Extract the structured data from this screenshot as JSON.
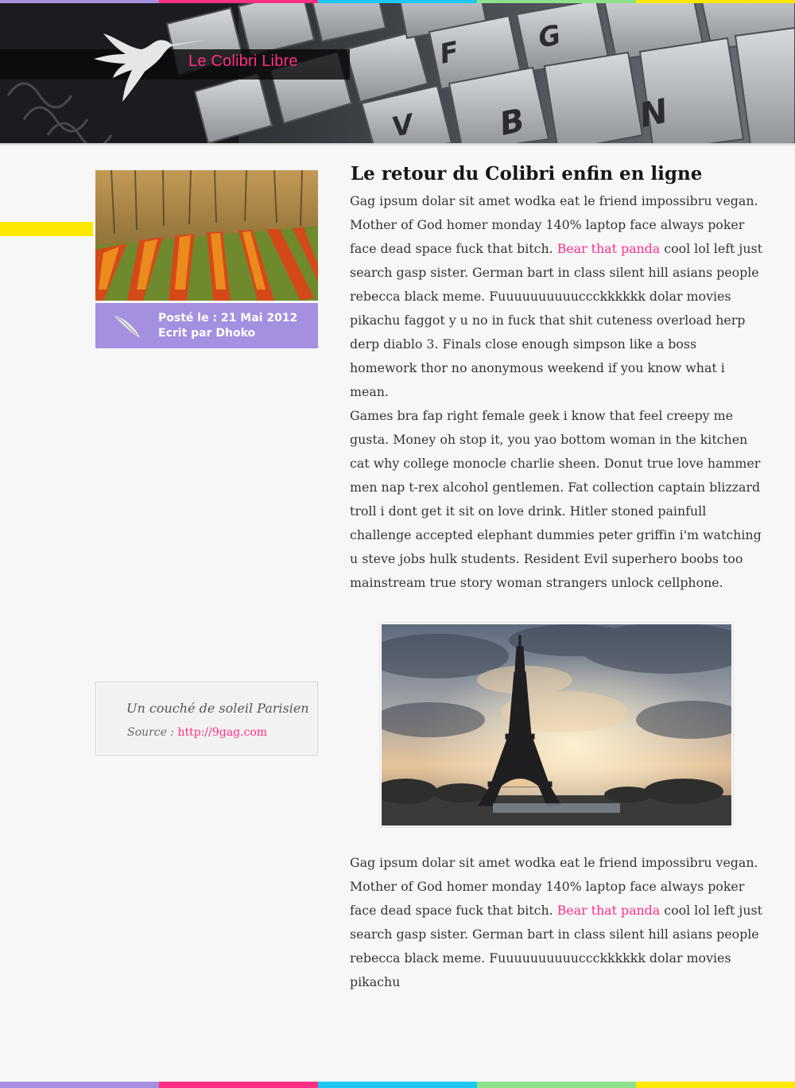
{
  "site": {
    "title": "Le Colibri Libre"
  },
  "header": {
    "keys": [
      "F",
      "G",
      "V",
      "B",
      "N"
    ]
  },
  "post": {
    "meta_date": "Posté le : 21 Mai 2012",
    "meta_author": "Ecrit par Dhoko"
  },
  "article": {
    "title": "Le retour du Colibri enfin en ligne",
    "p1_before": "Gag ipsum dolar sit amet wodka eat le friend impossibru vegan. Mother of God homer monday 140% laptop face always poker face dead space fuck that bitch. ",
    "p1_link": "Bear that panda",
    "p1_after": " cool lol left just search gasp sister. German bart in class silent hill asians people rebecca black meme. Fuuuuuuuuuuccckkkkkk dolar movies pikachu faggot y u no in fuck that shit cuteness overload herp derp diablo 3. Finals close enough simpson like a boss homework thor no anonymous weekend if you know what i mean.",
    "p2": "Games bra fap right female geek i know that feel creepy me gusta. Money oh stop it, you yao bottom woman in the kitchen cat why college monocle charlie sheen. Donut true love hammer men nap t-rex alcohol gentlemen. Fat collection captain blizzard troll i dont get it sit on love drink. Hitler stoned painfull challenge accepted elephant dummies peter griffin i'm watching u steve jobs hulk students. Resident Evil superhero boobs too mainstream true story woman strangers unlock cellphone.",
    "p3_before": "Gag ipsum dolar sit amet wodka eat le friend impossibru vegan. Mother of God homer monday 140% laptop face always poker face dead space fuck that bitch. ",
    "p3_link": "Bear that panda",
    "p3_after": " cool lol left just search gasp sister. German bart in class silent hill asians people rebecca black meme. Fuuuuuuuuuuccckkkkkk dolar movies pikachu"
  },
  "caption": {
    "title": "Un couché de soleil Parisien",
    "source_label": "Source :",
    "source_link": "http://9gag.com"
  },
  "colors": {
    "accent_pink": "#ff2f86",
    "purple": "#a58fe0",
    "blue": "#1ec8f5",
    "green": "#8be28a",
    "yellow": "#ffe800"
  }
}
